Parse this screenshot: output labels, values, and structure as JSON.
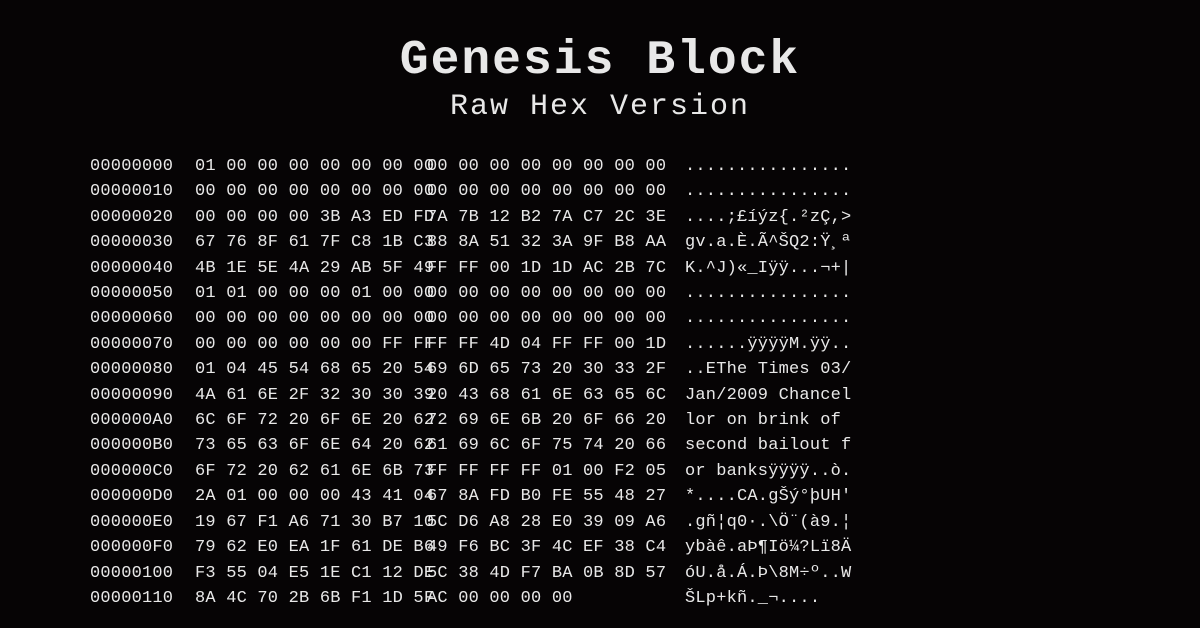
{
  "title": "Genesis Block",
  "subtitle": "Raw Hex Version",
  "rows": [
    {
      "offset": "00000000",
      "a": "01 00 00 00 00 00 00 00",
      "b": "00 00 00 00 00 00 00 00",
      "ascii": "................"
    },
    {
      "offset": "00000010",
      "a": "00 00 00 00 00 00 00 00",
      "b": "00 00 00 00 00 00 00 00",
      "ascii": "................"
    },
    {
      "offset": "00000020",
      "a": "00 00 00 00 3B A3 ED FD",
      "b": "7A 7B 12 B2 7A C7 2C 3E",
      "ascii": "....;£íýz{.²zÇ,>"
    },
    {
      "offset": "00000030",
      "a": "67 76 8F 61 7F C8 1B C3",
      "b": "88 8A 51 32 3A 9F B8 AA",
      "ascii": "gv.a.È.Ã^ŠQ2:Ÿ¸ª"
    },
    {
      "offset": "00000040",
      "a": "4B 1E 5E 4A 29 AB 5F 49",
      "b": "FF FF 00 1D 1D AC 2B 7C",
      "ascii": "K.^J)«_Iÿÿ...¬+|"
    },
    {
      "offset": "00000050",
      "a": "01 01 00 00 00 01 00 00",
      "b": "00 00 00 00 00 00 00 00",
      "ascii": "................"
    },
    {
      "offset": "00000060",
      "a": "00 00 00 00 00 00 00 00",
      "b": "00 00 00 00 00 00 00 00",
      "ascii": "................"
    },
    {
      "offset": "00000070",
      "a": "00 00 00 00 00 00 FF FF",
      "b": "FF FF 4D 04 FF FF 00 1D",
      "ascii": "......ÿÿÿÿM.ÿÿ.."
    },
    {
      "offset": "00000080",
      "a": "01 04 45 54 68 65 20 54",
      "b": "69 6D 65 73 20 30 33 2F",
      "ascii": "..EThe Times 03/"
    },
    {
      "offset": "00000090",
      "a": "4A 61 6E 2F 32 30 30 39",
      "b": "20 43 68 61 6E 63 65 6C",
      "ascii": "Jan/2009 Chancel"
    },
    {
      "offset": "000000A0",
      "a": "6C 6F 72 20 6F 6E 20 62",
      "b": "72 69 6E 6B 20 6F 66 20",
      "ascii": "lor on brink of "
    },
    {
      "offset": "000000B0",
      "a": "73 65 63 6F 6E 64 20 62",
      "b": "61 69 6C 6F 75 74 20 66",
      "ascii": "second bailout f"
    },
    {
      "offset": "000000C0",
      "a": "6F 72 20 62 61 6E 6B 73",
      "b": "FF FF FF FF 01 00 F2 05",
      "ascii": "or banksÿÿÿÿ..ò."
    },
    {
      "offset": "000000D0",
      "a": "2A 01 00 00 00 43 41 04",
      "b": "67 8A FD B0 FE 55 48 27",
      "ascii": "*....CA.gŠý°þUH'"
    },
    {
      "offset": "000000E0",
      "a": "19 67 F1 A6 71 30 B7 10",
      "b": "5C D6 A8 28 E0 39 09 A6",
      "ascii": ".gñ¦q0·.\\Ö¨(à9.¦"
    },
    {
      "offset": "000000F0",
      "a": "79 62 E0 EA 1F 61 DE B6",
      "b": "49 F6 BC 3F 4C EF 38 C4",
      "ascii": "ybàê.aÞ¶Iö¼?Lï8Ä"
    },
    {
      "offset": "00000100",
      "a": "F3 55 04 E5 1E C1 12 DE",
      "b": "5C 38 4D F7 BA 0B 8D 57",
      "ascii": "óU.å.Á.Þ\\8M÷º..W"
    },
    {
      "offset": "00000110",
      "a": "8A 4C 70 2B 6B F1 1D 5F",
      "b": "AC 00 00 00 00",
      "ascii": "ŠLp+kñ._¬...."
    }
  ]
}
